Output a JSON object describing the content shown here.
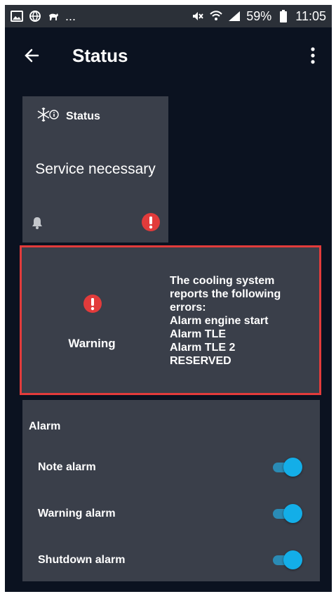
{
  "statusbar": {
    "left_icons": [
      "image-icon",
      "wifi-globe-icon",
      "animal-icon"
    ],
    "ellipsis": "...",
    "right_icons": [
      "mute-icon",
      "wifi-icon",
      "signal-icon"
    ],
    "battery_percent": "59%",
    "time": "11:05"
  },
  "appbar": {
    "title": "Status"
  },
  "status_card": {
    "heading": "Status",
    "message": "Service necessary"
  },
  "warning": {
    "label": "Warning",
    "lines": [
      "The cooling system",
      "reports the following",
      "errors:",
      "Alarm engine start",
      "Alarm TLE",
      "Alarm TLE 2",
      "RESERVED"
    ]
  },
  "alarm": {
    "title": "Alarm",
    "items": [
      {
        "label": "Note alarm",
        "on": true
      },
      {
        "label": "Warning alarm",
        "on": true
      },
      {
        "label": "Shutdown alarm",
        "on": true
      }
    ]
  },
  "colors": {
    "background": "#0b1220",
    "card": "#3a3f4a",
    "alert_red": "#e23b3b",
    "toggle_on": "#13aee8"
  }
}
